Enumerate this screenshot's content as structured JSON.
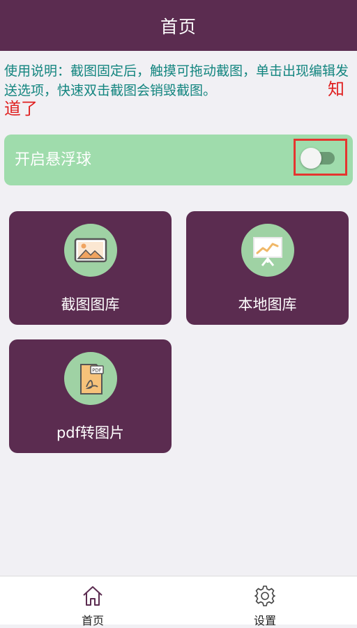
{
  "header": {
    "title": "首页"
  },
  "notice": {
    "text": "使用说明：截图固定后，触摸可拖动截图，单击出现编辑发送选项，快速双击截图会销毁截图。",
    "ack_line1": "知",
    "ack_line2": "道了"
  },
  "floating_ball": {
    "label": "开启悬浮球",
    "enabled": false
  },
  "tiles": [
    {
      "label": "截图图库",
      "icon": "image-gallery-icon"
    },
    {
      "label": "本地图库",
      "icon": "presentation-chart-icon"
    },
    {
      "label": "pdf转图片",
      "icon": "pdf-file-icon"
    }
  ],
  "tabbar": {
    "items": [
      {
        "label": "首页",
        "icon": "home-icon",
        "active": true
      },
      {
        "label": "设置",
        "icon": "gear-icon",
        "active": false
      }
    ]
  },
  "colors": {
    "header_bg": "#5b2c50",
    "tile_bg": "#5b2c50",
    "accent_green": "#9fdcac",
    "notice_text": "#13857f",
    "ack_text": "#e02020"
  }
}
